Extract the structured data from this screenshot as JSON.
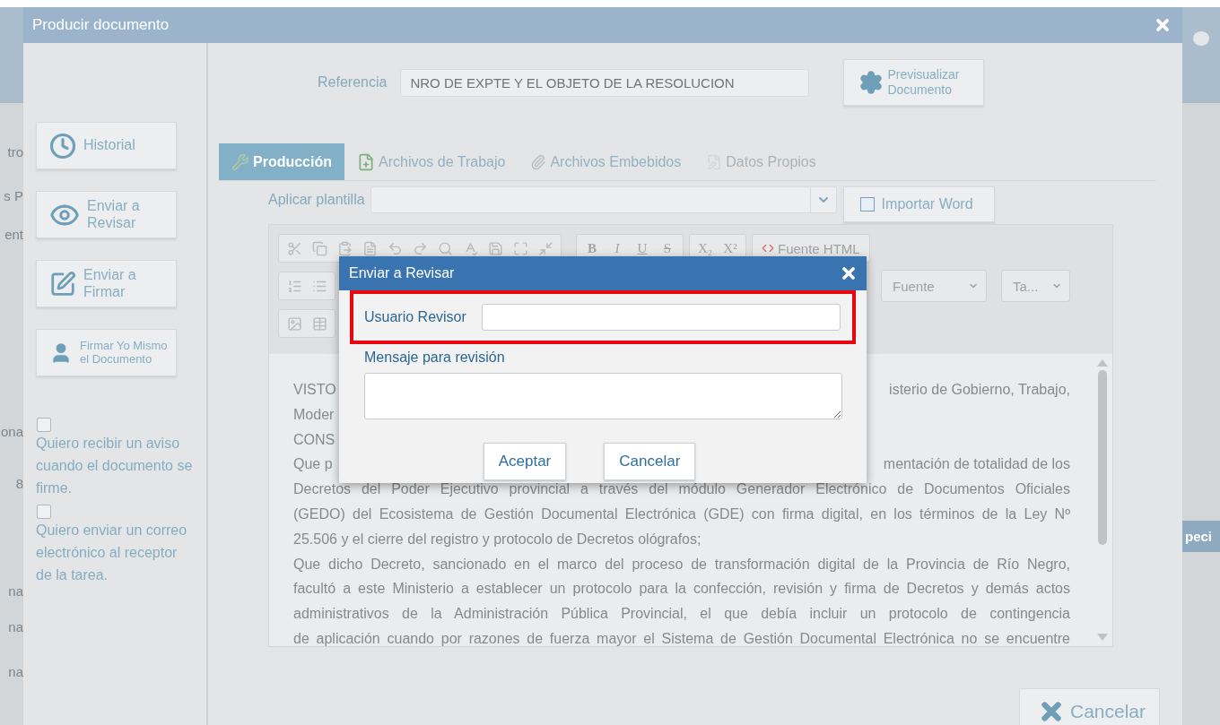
{
  "background_page": {
    "left_fragments": [
      "tro",
      "s P",
      "ent",
      "ona",
      "8",
      "na",
      "na",
      "na"
    ],
    "right_fragments": [
      "peci"
    ]
  },
  "window": {
    "title": "Producir documento"
  },
  "sidebar": {
    "actions": [
      {
        "kind": "history",
        "label": "Historial"
      },
      {
        "kind": "review",
        "label": "Enviar a Revisar"
      },
      {
        "kind": "sign",
        "label": "Enviar a Firmar"
      },
      {
        "kind": "self_sign",
        "label": "Firmar Yo Mismo el Documento"
      }
    ],
    "options": [
      {
        "label": "Quiero recibir un aviso cuando el documento se firme.",
        "checked": false
      },
      {
        "label": "Quiero enviar un correo electrónico al receptor de la tarea.",
        "checked": false
      }
    ]
  },
  "reference": {
    "label": "Referencia",
    "value": "NRO DE EXPTE Y EL OBJETO DE LA RESOLUCION"
  },
  "preview_button": "Previsualizar Documento",
  "tabs": [
    {
      "kind": "production",
      "label": "Producción",
      "selected": true,
      "disabled": false
    },
    {
      "kind": "work_files",
      "label": "Archivos de Trabajo",
      "selected": false,
      "disabled": false
    },
    {
      "kind": "embedded",
      "label": "Archivos Embebidos",
      "selected": false,
      "disabled": false
    },
    {
      "kind": "own_data",
      "label": "Datos Propios",
      "selected": false,
      "disabled": true
    }
  ],
  "template": {
    "label": "Aplicar plantilla"
  },
  "import_button": "Importar Word",
  "editor": {
    "format_buttons": [
      "B",
      "I",
      "U",
      "S"
    ],
    "script_buttons": [
      "X₂",
      "X²"
    ],
    "html_button": "Fuente HTML",
    "font_select": "Fuente",
    "size_select": "Ta...",
    "lines": [
      {
        "kind": "split",
        "left": "VISTO",
        "right": "isterio de Gobierno, Trabajo,"
      },
      {
        "kind": "split",
        "left": "Moder"
      },
      {
        "kind": "split",
        "left": "CONS"
      },
      {
        "kind": "split",
        "left": "Que p",
        "right": "mentación de totalidad de los"
      },
      {
        "kind": "full",
        "text": "Decretos del Poder Ejecutivo provincial a través del módulo Generador Electrónico de Documentos Oficiales"
      },
      {
        "kind": "full",
        "text": "(GEDO) del Ecosistema de Gestión Documental Electrónica (GDE) con firma digital, en los términos de la Ley Nº"
      },
      {
        "kind": "end",
        "text": "25.506 y el cierre del registro y protocolo de Decretos ológrafos;"
      },
      {
        "kind": "full",
        "text": "Que dicho Decreto, sancionado en el marco del proceso de transformación digital de la Provincia de Río Negro,"
      },
      {
        "kind": "full",
        "text": "facultó a este Ministerio a establecer un protocolo para la confección, revisión y firma de Decretos y demás actos"
      },
      {
        "kind": "full",
        "text": "administrativos de la Administración Pública Provincial, el que debía incluir un protocolo de contingencia"
      },
      {
        "kind": "full",
        "text": "de aplicación cuando por razones de fuerza mayor el Sistema de Gestión Documental Electrónica no se encuentre"
      }
    ]
  },
  "dialog": {
    "title": "Enviar a Revisar",
    "fields": [
      {
        "kind": "input",
        "label": "Usuario Revisor",
        "highlighted": true
      },
      {
        "kind": "textarea",
        "label": "Mensaje para revisión",
        "highlighted": false
      }
    ],
    "buttons": [
      "Aceptar",
      "Cancelar"
    ]
  },
  "footer_button": "Cancelar"
}
